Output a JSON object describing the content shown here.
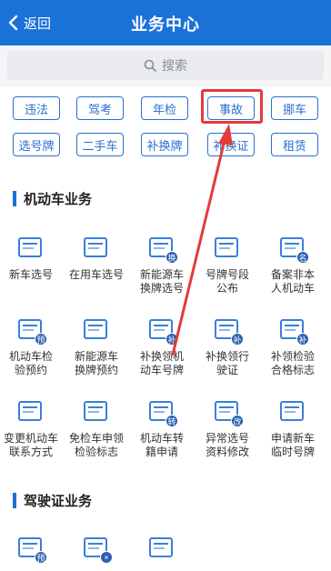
{
  "header": {
    "back_label": "返回",
    "title": "业务中心"
  },
  "search": {
    "placeholder": "搜索"
  },
  "tags": [
    {
      "label": "违法"
    },
    {
      "label": "驾考"
    },
    {
      "label": "年检"
    },
    {
      "label": "事故"
    },
    {
      "label": "挪车"
    },
    {
      "label": "选号牌"
    },
    {
      "label": "二手车"
    },
    {
      "label": "补换牌"
    },
    {
      "label": "补换证"
    },
    {
      "label": "租赁"
    }
  ],
  "sections": {
    "vehicle": {
      "title": "机动车业务",
      "items": [
        {
          "label": "新车选号",
          "icon": "license-plate-icon",
          "badge": ""
        },
        {
          "label": "在用车选号",
          "icon": "car-icon",
          "badge": ""
        },
        {
          "label": "新能源车\n换牌选号",
          "icon": "ev-car-icon",
          "badge": "换"
        },
        {
          "label": "号牌号段\n公布",
          "icon": "plate-announce-icon",
          "badge": ""
        },
        {
          "label": "备案非本\n人机动车",
          "icon": "record-document-icon",
          "badge": "名"
        },
        {
          "label": "机动车检\n验预约",
          "icon": "inspection-icon",
          "badge": "预"
        },
        {
          "label": "新能源车\n换牌预约",
          "icon": "ev-plate-icon",
          "badge": ""
        },
        {
          "label": "补换领机\n动车号牌",
          "icon": "replace-plate-icon",
          "badge": "补"
        },
        {
          "label": "补换领行\n驶证",
          "icon": "driving-permit-icon",
          "badge": "补"
        },
        {
          "label": "补领检验\n合格标志",
          "icon": "qualification-mark-icon",
          "badge": "补"
        },
        {
          "label": "变更机动车\n联系方式",
          "icon": "contact-card-icon",
          "badge": ""
        },
        {
          "label": "免检车申领\n检验标志",
          "icon": "exempt-badge-icon",
          "badge": ""
        },
        {
          "label": "机动车转\n籍申请",
          "icon": "transfer-icon",
          "badge": "转"
        },
        {
          "label": "异常选号\n资料修改",
          "icon": "edit-document-icon",
          "badge": "改"
        },
        {
          "label": "申请新车\n临时号牌",
          "icon": "temp-plate-icon",
          "badge": ""
        }
      ]
    },
    "license": {
      "title": "驾驶证业务",
      "items": [
        {
          "label": "",
          "icon": "license-card-icon",
          "badge": "预"
        },
        {
          "label": "",
          "icon": "calendar-icon",
          "badge": "×"
        },
        {
          "label": "",
          "icon": "speaker-card-icon",
          "badge": ""
        }
      ]
    }
  }
}
